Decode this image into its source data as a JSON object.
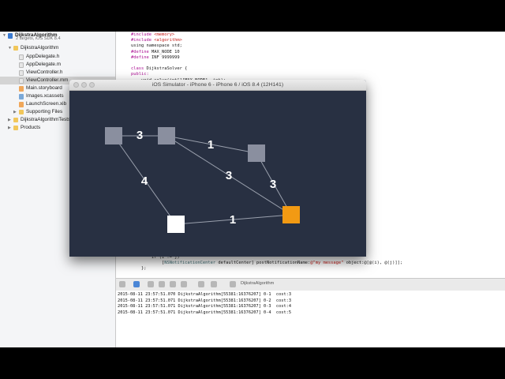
{
  "navigator": {
    "items": [
      {
        "label": "DijkstraAlgorithm",
        "icon": "project-icon",
        "indent": 0,
        "disclosure": "open",
        "bold": true
      },
      {
        "label": "DijkstraAlgorithm",
        "icon": "folder-icon",
        "indent": 1,
        "disclosure": "open"
      },
      {
        "label": "AppDelegate.h",
        "icon": "header-file-icon",
        "indent": 2
      },
      {
        "label": "AppDelegate.m",
        "icon": "source-file-icon",
        "indent": 2
      },
      {
        "label": "ViewController.h",
        "icon": "header-file-icon",
        "indent": 2
      },
      {
        "label": "ViewController.mm",
        "icon": "source-file-icon",
        "indent": 2,
        "selected": true
      },
      {
        "label": "Main.storyboard",
        "icon": "storyboard-icon",
        "indent": 2
      },
      {
        "label": "Images.xcassets",
        "icon": "asset-catalog-icon",
        "indent": 2
      },
      {
        "label": "LaunchScreen.xib",
        "icon": "xib-file-icon",
        "indent": 2
      },
      {
        "label": "Supporting Files",
        "icon": "folder-icon",
        "indent": 2,
        "disclosure": "closed"
      },
      {
        "label": "DijkstraAlgorithmTests",
        "icon": "folder-icon",
        "indent": 1,
        "disclosure": "closed"
      },
      {
        "label": "Products",
        "icon": "folder-icon",
        "indent": 1,
        "disclosure": "closed"
      }
    ],
    "project_subtitle": "2 targets, iOS SDK 8.4"
  },
  "editor": {
    "lines": [
      [
        {
          "t": "#include ",
          "c": "kw"
        },
        {
          "t": "<memory>",
          "c": "str"
        }
      ],
      [
        {
          "t": "#include ",
          "c": "kw"
        },
        {
          "t": "<algorithm>",
          "c": "str"
        }
      ],
      [
        {
          "t": "using namespace std;",
          "c": ""
        }
      ],
      [
        {
          "t": "#define ",
          "c": "kw"
        },
        {
          "t": "MAX_NODE 10",
          "c": ""
        }
      ],
      [
        {
          "t": "#define ",
          "c": "kw"
        },
        {
          "t": "INF 9999999",
          "c": ""
        }
      ],
      [
        {
          "t": "",
          "c": ""
        }
      ],
      [
        {
          "t": "class ",
          "c": "kw"
        },
        {
          "t": "DijkstraSolver {",
          "c": ""
        }
      ],
      [
        {
          "t": "public:",
          "c": "kw"
        }
      ],
      [
        {
          "t": "    void solve(int[][MAX_NODE], int);",
          "c": ""
        }
      ]
    ],
    "bottom_lines": [
      [
        {
          "t": "        if (i != j)",
          "c": ""
        }
      ],
      [
        {
          "t": "            [",
          "c": ""
        },
        {
          "t": "NSNotificationCenter",
          "c": "cls"
        },
        {
          "t": " defaultCenter] postNotificationName:",
          "c": ""
        },
        {
          "t": "@\"my message\"",
          "c": "str"
        },
        {
          "t": " object:@[@(i), @(j)]];",
          "c": ""
        }
      ],
      [
        {
          "t": "    };",
          "c": ""
        }
      ]
    ]
  },
  "debug_bar": {
    "target": "DijkstraAlgorithm"
  },
  "console": {
    "lines": [
      "2015-08-11 23:57:51.070 DijkstraAlgorithm[55381:16376207] 0-1  cost:3",
      "2015-08-11 23:57:51.071 DijkstraAlgorithm[55381:16376207] 0-2  cost:3",
      "2015-08-11 23:57:51.071 DijkstraAlgorithm[55381:16376207] 0-3  cost:4",
      "2015-08-11 23:57:51.071 DijkstraAlgorithm[55381:16376207] 0-4  cost:5"
    ]
  },
  "simulator": {
    "title": "iOS Simulator - iPhone 6 - iPhone 6 / iOS 8.4 (12H141)",
    "background": "#283042",
    "nodes": [
      {
        "id": "n0",
        "color": "#8a8f9f"
      },
      {
        "id": "n1",
        "color": "#8a8f9f"
      },
      {
        "id": "n2",
        "color": "#8a8f9f"
      },
      {
        "id": "n3",
        "color": "#ffffff"
      },
      {
        "id": "n4",
        "color": "#f29a13"
      }
    ],
    "edges": [
      {
        "from": "n0",
        "to": "n1",
        "weight": "3"
      },
      {
        "from": "n1",
        "to": "n2",
        "weight": "1"
      },
      {
        "from": "n1",
        "to": "n4",
        "weight": "3"
      },
      {
        "from": "n2",
        "to": "n4",
        "weight": "3"
      },
      {
        "from": "n0",
        "to": "n3",
        "weight": "4"
      },
      {
        "from": "n3",
        "to": "n4",
        "weight": "1"
      }
    ]
  }
}
